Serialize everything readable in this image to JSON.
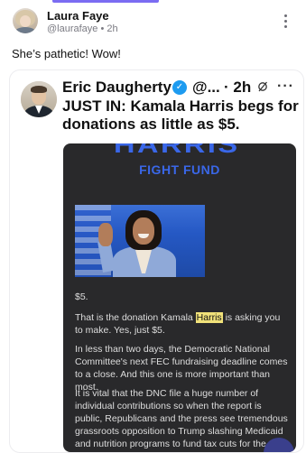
{
  "post": {
    "author_name": "Laura Faye",
    "author_handle": "@laurafaye",
    "time": "2h",
    "text": "She’s pathetic! Wow!"
  },
  "embedded": {
    "author_name": "Eric Daugherty",
    "handle": "@...",
    "time": "· 2h",
    "more": "···",
    "headline": "JUST IN: Kamala Harris begs for donations as little as $5.",
    "email": {
      "banner_partial": "HARRIS",
      "banner_title": "FIGHT FUND",
      "amount": "$5.",
      "p1_before": "That is the donation Kamala ",
      "p1_highlight": "Harris",
      "p1_after": " is asking you to make. Yes, just $5.",
      "p2": "In less than two days, the Democratic National Committee's next FEC fundraising deadline comes to a close. And this one is more important than most.",
      "p3": "It is vital that the DNC file a huge number of individual contributions so when the report is public, Republicans and the press see tremendous grassroots opposition to Trump slashing Medicaid and nutrition programs to fund tax cuts for the rich"
    }
  },
  "colors": {
    "accent": "#7b6cf2",
    "verified": "#1d9bf0",
    "banner_blue": "#3a67e8",
    "email_bg": "#29292b",
    "highlight": "#f1e27a"
  }
}
